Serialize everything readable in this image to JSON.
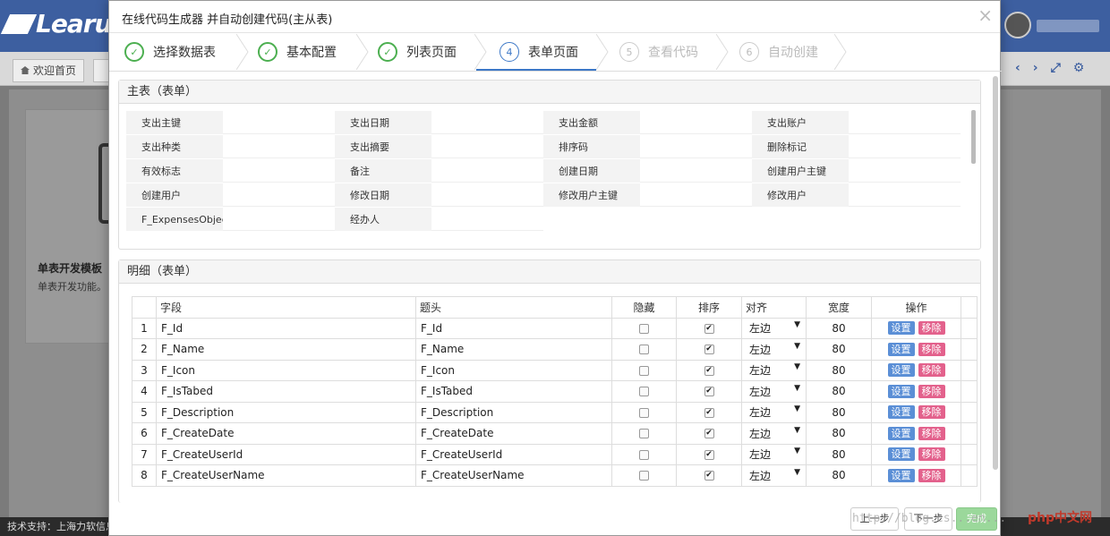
{
  "app": {
    "logo": "Learu",
    "home_tab": "欢迎首页",
    "card_title": "单表开发模板",
    "card_desc": "单表开发功能。",
    "footer": "技术支持：上海力软信息",
    "tools": [
      "‹",
      "›",
      "⤢",
      "⚙"
    ]
  },
  "modal": {
    "title": "在线代码生成器 并自动创建代码(主从表)",
    "close": "×"
  },
  "steps": [
    {
      "num": "✓",
      "label": "选择数据表",
      "state": "done"
    },
    {
      "num": "✓",
      "label": "基本配置",
      "state": "done"
    },
    {
      "num": "✓",
      "label": "列表页面",
      "state": "done"
    },
    {
      "num": "4",
      "label": "表单页面",
      "state": "active"
    },
    {
      "num": "5",
      "label": "查看代码",
      "state": "todo"
    },
    {
      "num": "6",
      "label": "自动创建",
      "state": "todo"
    }
  ],
  "main_panel": {
    "title": "主表（表单）",
    "rows": [
      [
        "支出主键",
        "支出日期",
        "支出金额",
        "支出账户"
      ],
      [
        "支出种类",
        "支出摘要",
        "排序码",
        "删除标记"
      ],
      [
        "有效标志",
        "备注",
        "创建日期",
        "创建用户主键"
      ],
      [
        "创建用户",
        "修改日期",
        "修改用户主键",
        "修改用户"
      ],
      [
        "F_ExpensesObject",
        "经办人",
        "",
        ""
      ]
    ]
  },
  "detail_panel": {
    "title": "明细（表单）",
    "columns": {
      "field": "字段",
      "header": "题头",
      "hidden": "隐藏",
      "sort": "排序",
      "align": "对齐",
      "width": "宽度",
      "ops": "操作"
    },
    "rows": [
      {
        "n": "1",
        "field": "F_Id",
        "header": "F_Id",
        "hidden": false,
        "sort": true,
        "align": "左边",
        "width": "80"
      },
      {
        "n": "2",
        "field": "F_Name",
        "header": "F_Name",
        "hidden": false,
        "sort": true,
        "align": "左边",
        "width": "80"
      },
      {
        "n": "3",
        "field": "F_Icon",
        "header": "F_Icon",
        "hidden": false,
        "sort": true,
        "align": "左边",
        "width": "80"
      },
      {
        "n": "4",
        "field": "F_IsTabed",
        "header": "F_IsTabed",
        "hidden": false,
        "sort": true,
        "align": "左边",
        "width": "80"
      },
      {
        "n": "5",
        "field": "F_Description",
        "header": "F_Description",
        "hidden": false,
        "sort": true,
        "align": "左边",
        "width": "80"
      },
      {
        "n": "6",
        "field": "F_CreateDate",
        "header": "F_CreateDate",
        "hidden": false,
        "sort": true,
        "align": "左边",
        "width": "80"
      },
      {
        "n": "7",
        "field": "F_CreateUserId",
        "header": "F_CreateUserId",
        "hidden": false,
        "sort": true,
        "align": "左边",
        "width": "80"
      },
      {
        "n": "8",
        "field": "F_CreateUserName",
        "header": "F_CreateUserName",
        "hidden": false,
        "sort": true,
        "align": "左边",
        "width": "80"
      }
    ],
    "set_label": "设置",
    "remove_label": "移除"
  },
  "footer": {
    "prev": "上一步",
    "next": "下一步",
    "finish": "完成"
  },
  "watermark": "http://blog.cs...en...",
  "watermark_logo": "php中文网"
}
